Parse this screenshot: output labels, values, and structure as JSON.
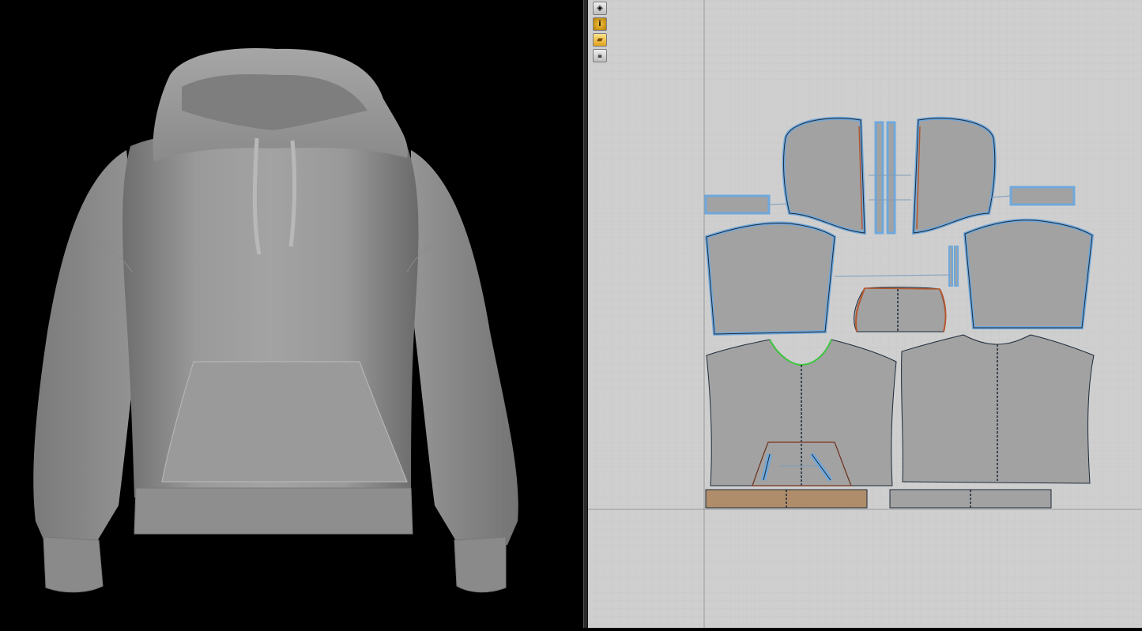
{
  "window": {
    "title": ""
  },
  "viewport_3d": {
    "background": "#000000",
    "garment": "hoodie",
    "fabric_color": "#8f8f8f"
  },
  "viewport_2d": {
    "background": "#cfcfcf",
    "grid_color": "#c3c3c3",
    "piece_fill": "#a2a2a2",
    "selected_outline": "#6fa8dc",
    "seam_colors": {
      "orange": "#b5572f",
      "green": "#3ec43e",
      "dark": "#1d2a3a"
    },
    "rib_fill_selected": "#b08d6a",
    "toolbar": [
      {
        "name": "display-3d-icon"
      },
      {
        "name": "info-icon"
      },
      {
        "name": "fabric-icon"
      },
      {
        "name": "lock-icon"
      }
    ]
  }
}
